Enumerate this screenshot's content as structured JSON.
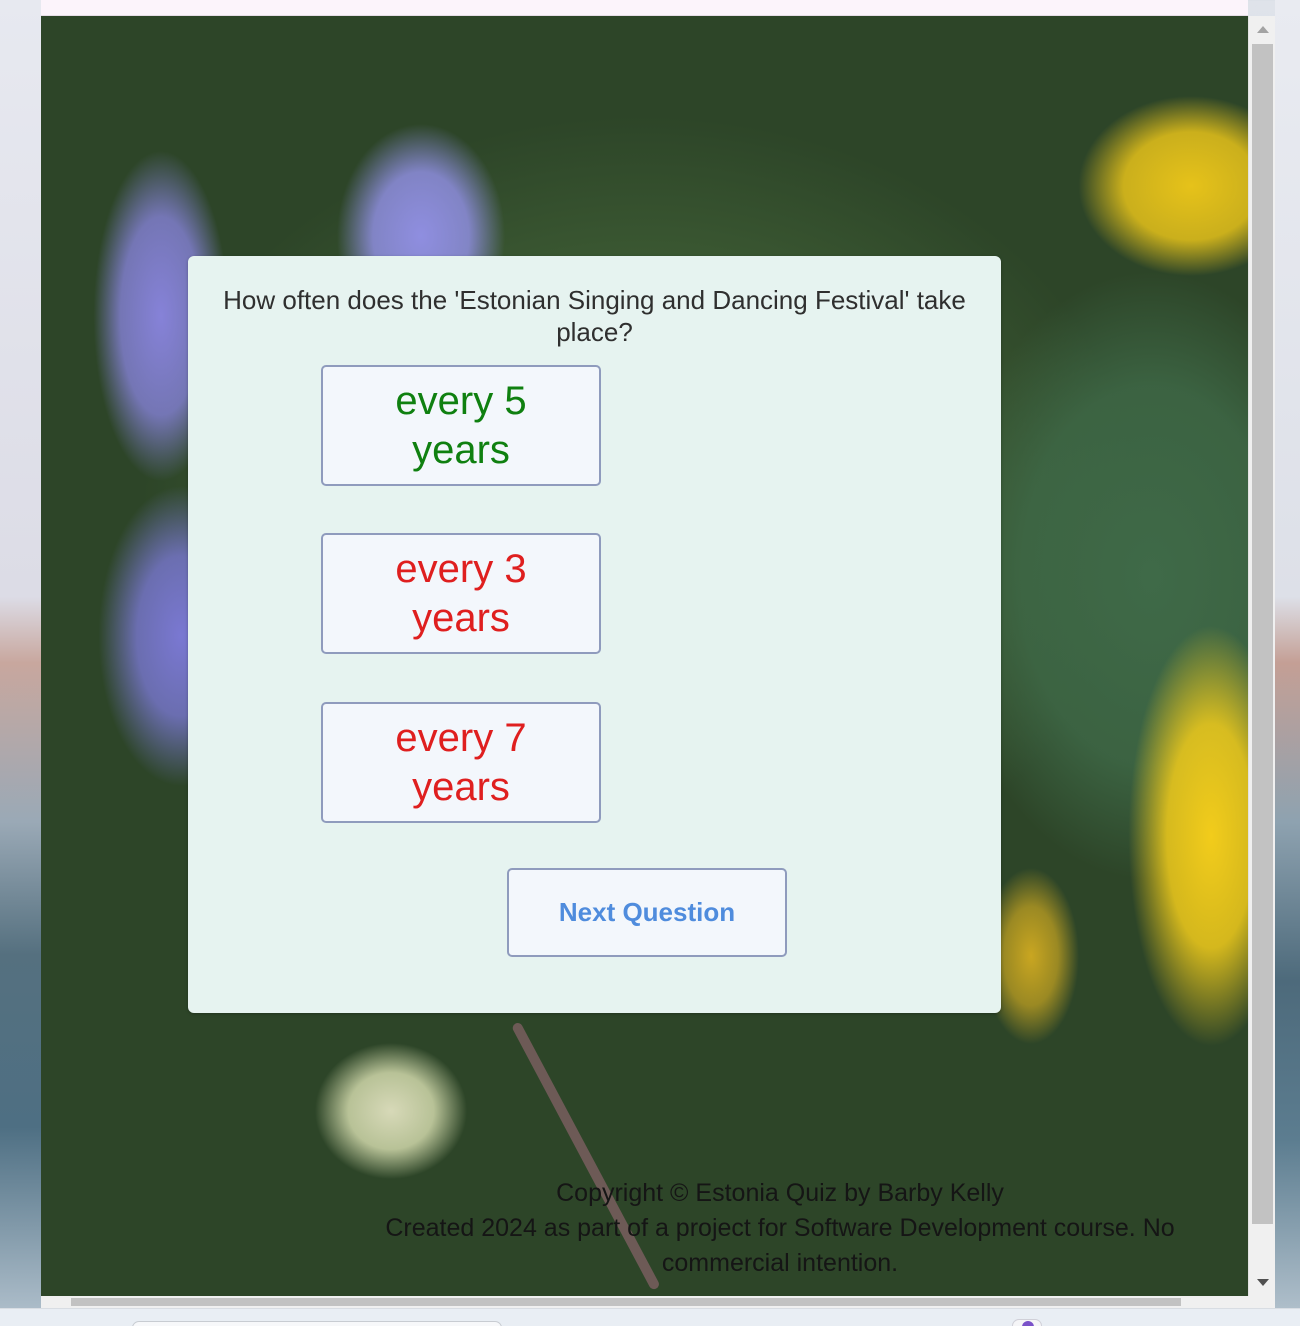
{
  "quiz": {
    "question": "How often does the 'Estonian Singing and Dancing Festival' take place?",
    "answers": [
      {
        "label": "every 5 years",
        "state": "correct",
        "color": "#0f8010"
      },
      {
        "label": "every 3 years",
        "state": "wrong",
        "color": "#df1f1f"
      },
      {
        "label": "every 7 years",
        "state": "wrong",
        "color": "#df1f1f"
      }
    ],
    "next_label": "Next Question"
  },
  "footer": {
    "copyright": "Copyright © Estonia Quiz by Barby Kelly",
    "note": "Created 2024 as part of a project for Software Development course. No commercial intention."
  },
  "colors": {
    "card_bg": "#e6f3f0",
    "button_bg": "#f3f7fc",
    "button_border": "#8f9bbd",
    "next_text": "#4f8cdd"
  }
}
